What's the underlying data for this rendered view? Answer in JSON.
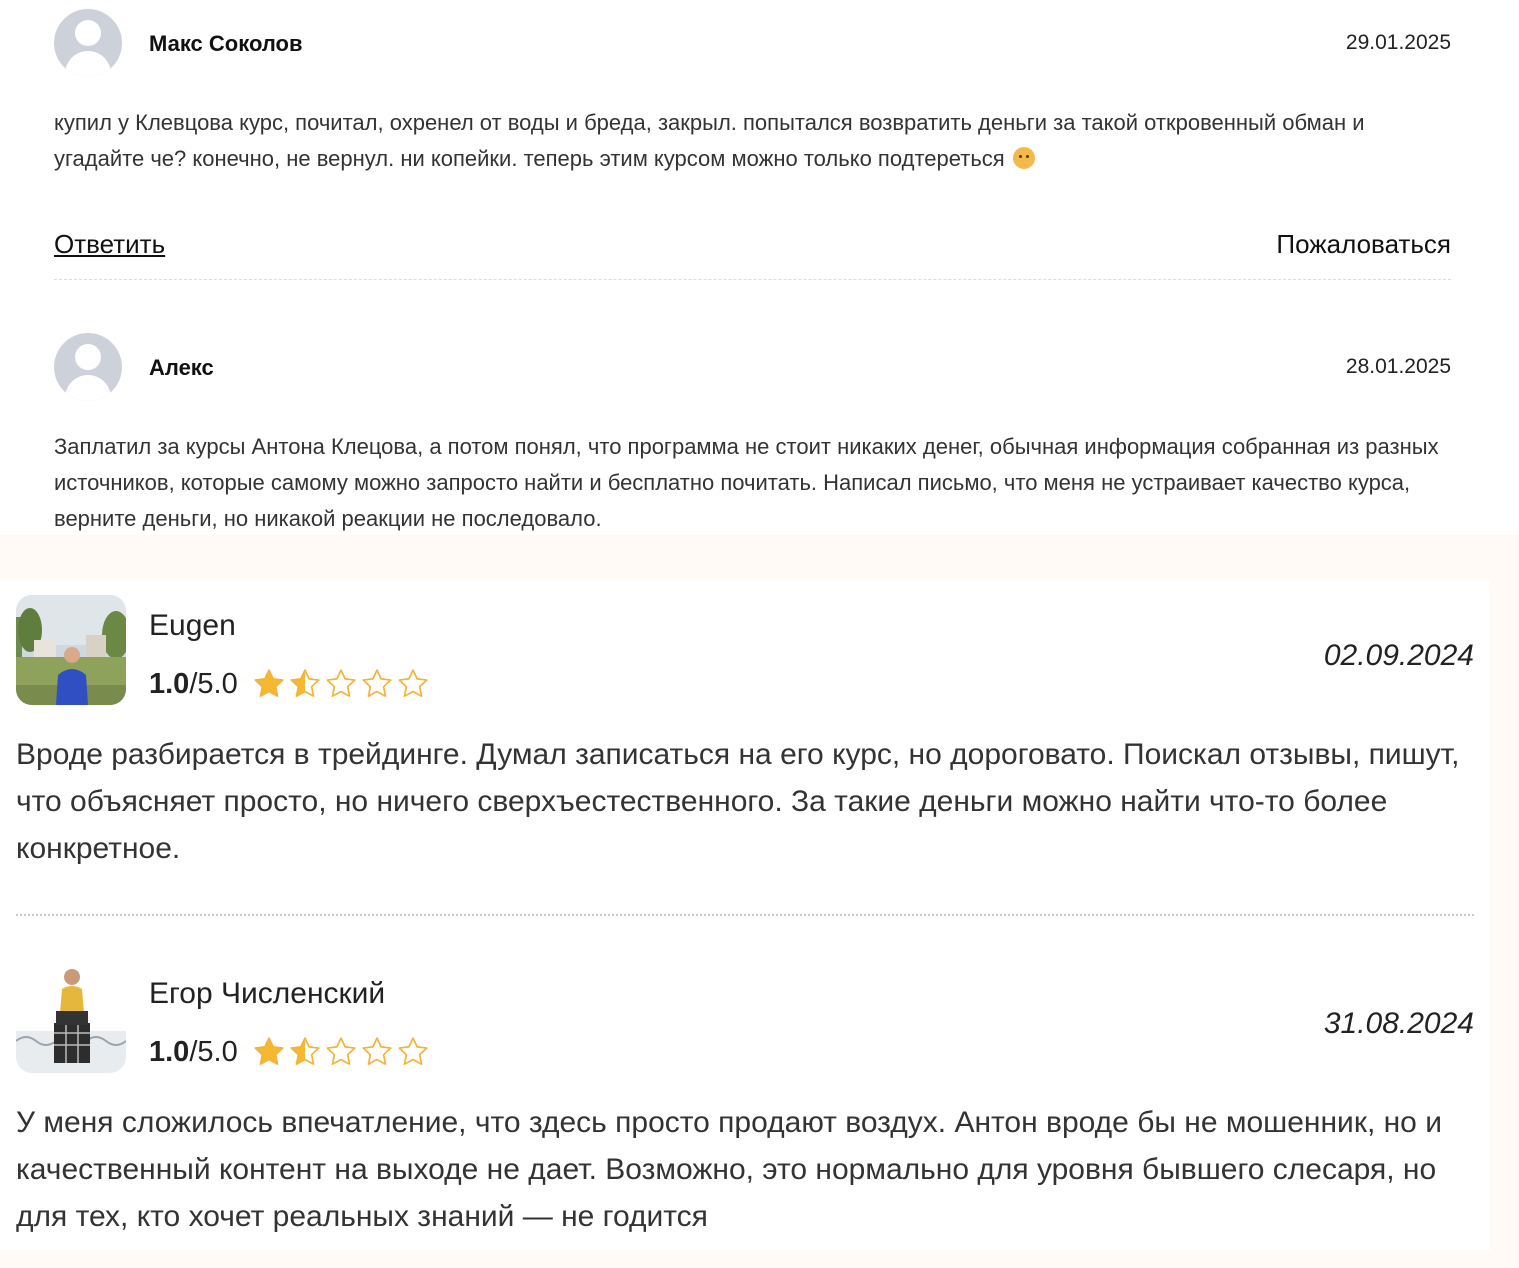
{
  "site1": {
    "actions": {
      "reply_label": "Ответить",
      "report_label": "Пожаловаться"
    },
    "comments": [
      {
        "author": "Макс Соколов",
        "date": "29.01.2025",
        "text": "купил у Клевцова курс, почитал, охренел от воды и бреда, закрыл. попытался возвратить деньги за такой откровенный обман и угадайте че? конечно, не вернул. ни копейки. теперь этим курсом можно только подтереться",
        "avatar_icon": "user-placeholder-icon",
        "emoji_icon": "slightly-smiling-face-icon"
      },
      {
        "author": "Алекс",
        "date": "28.01.2025",
        "text": "Заплатил за курсы Антона Клецова, а потом понял, что программа не стоит никаких денег, обычная информация собранная из разных источников, которые самому можно запросто найти и бесплатно почитать. Написал письмо, что меня не устраивает качество курса, верните деньги, но никакой реакции не последовало.",
        "avatar_icon": "user-placeholder-icon"
      }
    ]
  },
  "site2": {
    "reviews": [
      {
        "author": "Eugen",
        "score": "1.0",
        "max_score": "/5.0",
        "stars_filled_fraction": 0.3,
        "date": "02.09.2024",
        "text": "Вроде разбирается в трейдинге. Думал записаться на его курс, но дороговато. Поискал отзывы, пишут, что объясняет просто, но ничего сверхъестественного. За такие деньги можно найти что-то более конкретное."
      },
      {
        "author": "Егор Численский",
        "score": "1.0",
        "max_score": "/5.0",
        "stars_filled_fraction": 0.3,
        "date": "31.08.2024",
        "text": "У меня сложилось впечатление, что здесь просто продают воздух. Антон вроде бы не мошенник, но и качественный контент на выходе не дает. Возможно, это нормально для уровня бывшего слесаря, но для тех, кто хочет реальных знаний — не годится"
      }
    ]
  },
  "colors": {
    "star_gold": "#f5b82e",
    "star_outline": "#f2b43a",
    "page_bg": "#fffaf5",
    "avatar_placeholder": "#cdd1d9"
  }
}
